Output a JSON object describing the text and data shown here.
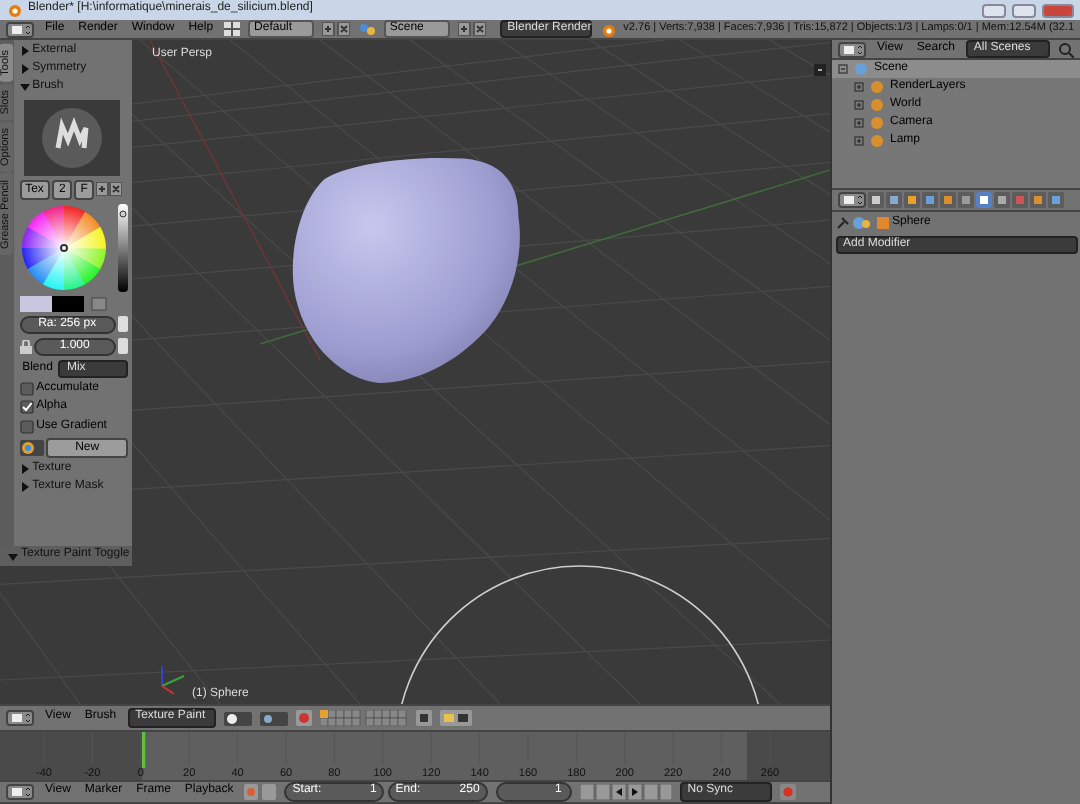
{
  "window": {
    "title": "Blender* [H:\\informatique\\minerais_de_silicium.blend]"
  },
  "info_header": {
    "menus": [
      "File",
      "Render",
      "Window",
      "Help"
    ],
    "screen_layout": "Default",
    "scene": "Scene",
    "render_engine": "Blender Render",
    "stats": "v2.76 | Verts:7,938 | Faces:7,936 | Tris:15,872 | Objects:1/3 | Lamps:0/1 | Mem:12.54M (32.1"
  },
  "tool_shelf": {
    "tabs": [
      {
        "label": "Tools",
        "selected": true
      },
      {
        "label": "Slots",
        "selected": false
      },
      {
        "label": "Options",
        "selected": false
      },
      {
        "label": "Grease Pencil",
        "selected": false
      }
    ],
    "panels_top": [
      {
        "label": "External",
        "expanded": false
      },
      {
        "label": "Symmetry",
        "expanded": false
      },
      {
        "label": "Brush",
        "expanded": true
      }
    ],
    "brush": {
      "tex_label": "Tex",
      "users": "2",
      "fake_user": "F",
      "radius": "Ra: 256 px",
      "strength": "1.000",
      "blend_label": "Blend",
      "blend": "Mix",
      "options": [
        {
          "label": "Accumulate",
          "checked": false
        },
        {
          "label": "Alpha",
          "checked": true
        },
        {
          "label": "Use Gradient",
          "checked": false
        }
      ],
      "new_button": "New"
    },
    "panels_bottom": [
      {
        "label": "Texture",
        "expanded": false
      },
      {
        "label": "Texture Mask",
        "expanded": false
      }
    ],
    "operator": "Texture Paint Toggle"
  },
  "viewport": {
    "view_name": "User Persp",
    "object_label": "(1) Sphere"
  },
  "view3d_header": {
    "menus": [
      "View",
      "Brush"
    ],
    "mode": "Texture Paint"
  },
  "timeline": {
    "ticks": [
      "-40",
      "-20",
      "0",
      "20",
      "40",
      "60",
      "80",
      "100",
      "120",
      "140",
      "160",
      "180",
      "200",
      "220",
      "240",
      "260"
    ],
    "header": {
      "menus": [
        "View",
        "Marker",
        "Frame",
        "Playback"
      ],
      "start_label": "Start:",
      "start": "1",
      "end_label": "End:",
      "end": "250",
      "current": "1",
      "sync": "No Sync"
    }
  },
  "outliner": {
    "menus": [
      "View",
      "Search"
    ],
    "display": "All Scenes",
    "tree": [
      {
        "label": "Scene",
        "expanded": true,
        "children": [
          {
            "label": "RenderLayers",
            "expanded": false
          },
          {
            "label": "World",
            "expanded": false
          },
          {
            "label": "Camera",
            "expanded": false
          },
          {
            "label": "Lamp",
            "expanded": false
          }
        ]
      }
    ]
  },
  "properties": {
    "object": "Sphere",
    "add_modifier": "Add Modifier"
  }
}
